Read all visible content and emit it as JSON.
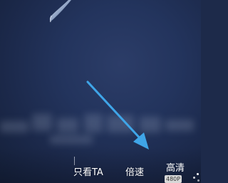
{
  "player": {
    "controls": {
      "only_ta_label": "只看TA",
      "speed_label": "倍速",
      "quality_label": "高清",
      "quality_badge": "480P"
    }
  },
  "icons": {
    "loading": "loading-spinner-icon",
    "pointer_arrow": "annotation-arrow"
  },
  "colors": {
    "background": "#1d2a4a",
    "arrow": "#3fa5e8",
    "text": "#ffffff",
    "badge_bg": "#d8d8d8"
  }
}
